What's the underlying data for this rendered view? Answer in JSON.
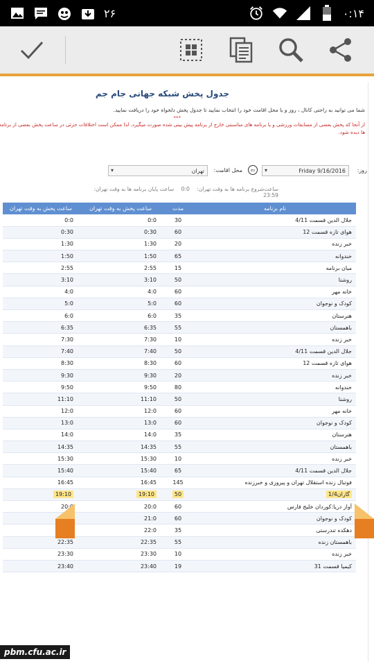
{
  "statusbar": {
    "notif_count": "۲۶",
    "time": "۰:۱۴"
  },
  "actionbar": {
    "icons": [
      "check-icon",
      "select-grid-icon",
      "copy-icon",
      "search-icon",
      "share-icon"
    ]
  },
  "page": {
    "title": "جدول پخش شبکه جهانی جام جم",
    "desc1": "شما می توانید به راحتی کانال ، روز و یا محل اقامت خود را انتخاب نمایید تا جدول پخش دلخواه خود را دریافت نمایید.",
    "stars": "***",
    "desc2": "از آنجا که پخش بعضی از مسابقات ورزشی و یا برنامه های مناسبتی خارج از برنامه پیش بینی شده صورت میگیرد، لذا ممکن است اختلافات جزئی در ساعت پخش بعضی از برنامه ها دیده شود."
  },
  "filters": {
    "day_label": "روز:",
    "day_value": "Friday 9/16/2016",
    "residence_label": "محل اقامت:",
    "residence_value": "تهران"
  },
  "times": {
    "start_label": "ساعت‌شروع برنامه ها به وقت تهران:",
    "start_value": "0:0",
    "end_label": "ساعت پایان برنامه ها به وقت تهران:",
    "end_value": "23:59"
  },
  "table": {
    "headers": {
      "name": "نام برنامه",
      "duration": "مدت",
      "time_tehran": "ساعت پخش به وقت تهران",
      "time_tehran2": "ساعت پخش به وقت تهران"
    },
    "rows": [
      {
        "name": "جلال الدین قسمت 4/11",
        "dur": "30",
        "t1": "0:0",
        "t2": "0:0"
      },
      {
        "name": "هوای تازه قسمت 12",
        "dur": "60",
        "t1": "0:30",
        "t2": "0:30"
      },
      {
        "name": "خبر زنده",
        "dur": "20",
        "t1": "1:30",
        "t2": "1:30"
      },
      {
        "name": "خندوانه",
        "dur": "65",
        "t1": "1:50",
        "t2": "1:50"
      },
      {
        "name": "میان برنامه",
        "dur": "15",
        "t1": "2:55",
        "t2": "2:55"
      },
      {
        "name": "روشنا",
        "dur": "50",
        "t1": "3:10",
        "t2": "3:10"
      },
      {
        "name": "خانه مهر",
        "dur": "60",
        "t1": "4:0",
        "t2": "4:0"
      },
      {
        "name": "کودک و نوجوان",
        "dur": "60",
        "t1": "5:0",
        "t2": "5:0"
      },
      {
        "name": "هنرستان",
        "dur": "35",
        "t1": "6:0",
        "t2": "6:0"
      },
      {
        "name": "باهمستان",
        "dur": "55",
        "t1": "6:35",
        "t2": "6:35"
      },
      {
        "name": "خبر زنده",
        "dur": "10",
        "t1": "7:30",
        "t2": "7:30"
      },
      {
        "name": "جلال الدین قسمت 4/11",
        "dur": "50",
        "t1": "7:40",
        "t2": "7:40"
      },
      {
        "name": "هوای تازه قسمت 12",
        "dur": "60",
        "t1": "8:30",
        "t2": "8:30"
      },
      {
        "name": "خبر زنده",
        "dur": "20",
        "t1": "9:30",
        "t2": "9:30"
      },
      {
        "name": "خندوانه",
        "dur": "80",
        "t1": "9:50",
        "t2": "9:50"
      },
      {
        "name": "روشنا",
        "dur": "50",
        "t1": "11:10",
        "t2": "11:10"
      },
      {
        "name": "خانه مهر",
        "dur": "60",
        "t1": "12:0",
        "t2": "12:0"
      },
      {
        "name": "کودک و نوجوان",
        "dur": "60",
        "t1": "13:0",
        "t2": "13:0"
      },
      {
        "name": "هنرستان",
        "dur": "35",
        "t1": "14:0",
        "t2": "14:0"
      },
      {
        "name": "باهمستان",
        "dur": "55",
        "t1": "14:35",
        "t2": "14:35"
      },
      {
        "name": "خبر زنده",
        "dur": "10",
        "t1": "15:30",
        "t2": "15:30"
      },
      {
        "name": "جلال الدین قسمت 4/11",
        "dur": "65",
        "t1": "15:40",
        "t2": "15:40"
      },
      {
        "name": "فوتبال زنده استقلال تهران و پیروزی و خبرزنده",
        "dur": "145",
        "t1": "16:45",
        "t2": "16:45"
      },
      {
        "name": "گاران1/4",
        "dur": "50",
        "t1": "19:10",
        "t2": "19:10",
        "highlight": true
      },
      {
        "name": "آواز دریا:کوردان خلیج فارس",
        "dur": "60",
        "t1": "20:0",
        "t2": "20:0"
      },
      {
        "name": "کودک و نوجوان",
        "dur": "60",
        "t1": "21:0",
        "t2": "21:0"
      },
      {
        "name": "دهکده تندرستی",
        "dur": "35",
        "t1": "22:0",
        "t2": "22:0"
      },
      {
        "name": "باهمستان زنده",
        "dur": "55",
        "t1": "22:35",
        "t2": "22:35"
      },
      {
        "name": "خبر زنده",
        "dur": "10",
        "t1": "23:30",
        "t2": "23:30"
      },
      {
        "name": "کیمیا قسمت 31",
        "dur": "19",
        "t1": "23:40",
        "t2": "23:40"
      }
    ]
  },
  "watermark": "pbm.cfu.ac.ir",
  "colors": {
    "accent": "#e8a33a",
    "header_blue": "#5f8fd1",
    "title_blue": "#2a4b7c",
    "warning_red": "#c62828",
    "highlight_yellow": "#ffe58a",
    "pointer_orange": "#e67e22"
  }
}
